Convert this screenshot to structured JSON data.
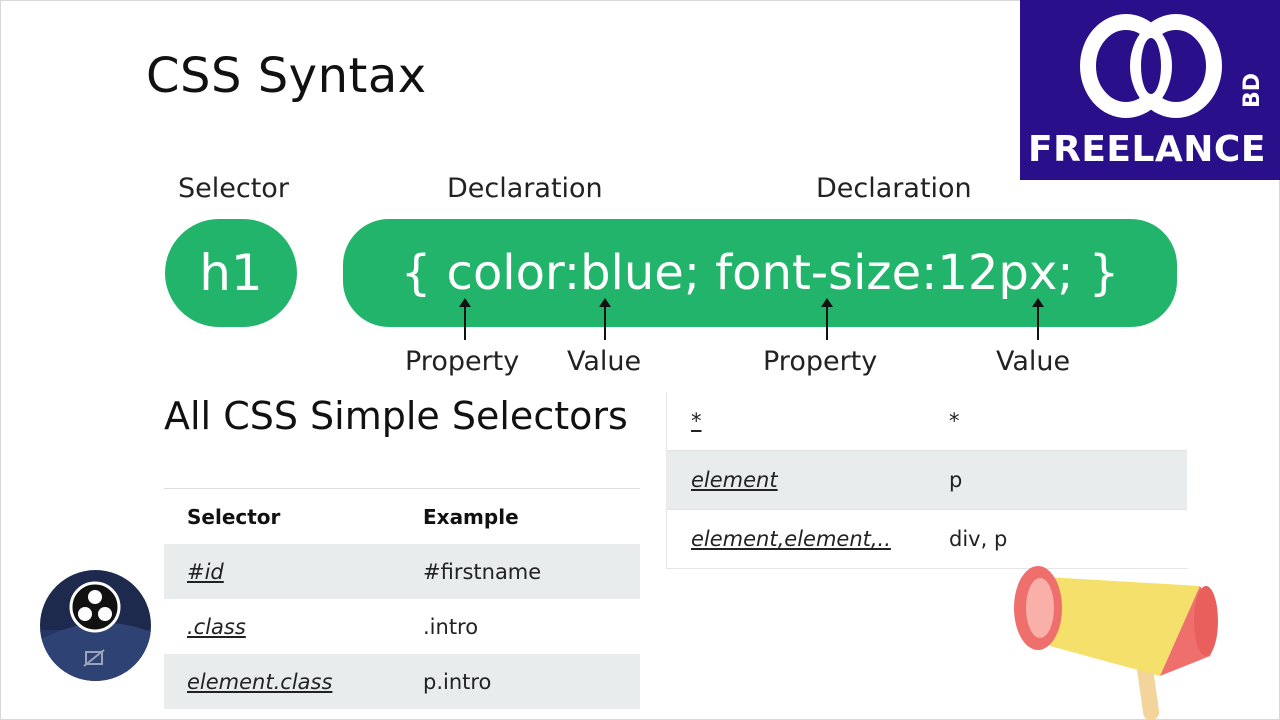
{
  "slide": {
    "title": "CSS Syntax",
    "syntax_labels": {
      "selector": "Selector",
      "declaration_1": "Declaration",
      "declaration_2": "Declaration",
      "property_1": "Property",
      "value_1": "Value",
      "property_2": "Property",
      "value_2": "Value"
    },
    "selector_pill": "h1",
    "declaration_pill": "{ color:blue; font-size:12px; }",
    "section_title": "All CSS Simple Selectors"
  },
  "selectors_table": {
    "headers": [
      "Selector",
      "Example"
    ],
    "rows": [
      {
        "selector": "#id",
        "example": "#firstname"
      },
      {
        "selector": ".class",
        "example": ".intro"
      },
      {
        "selector": "element.class",
        "example": "p.intro"
      }
    ]
  },
  "selectors_table_2": {
    "rows": [
      {
        "selector": "*",
        "example": "*"
      },
      {
        "selector": "element",
        "example": "p"
      },
      {
        "selector": "element,element,..",
        "example": "div, p"
      }
    ]
  },
  "logo": {
    "text": "FREELANCE",
    "badge": "BD"
  },
  "colors": {
    "accent_green": "#22b46a",
    "logo_bg": "#2a0f8a",
    "row_alt": "#e9ecec"
  },
  "icons": {
    "logo_rings": "interlocking-rings-icon",
    "camera_app": "obs-icon",
    "megaphone": "megaphone-icon"
  }
}
